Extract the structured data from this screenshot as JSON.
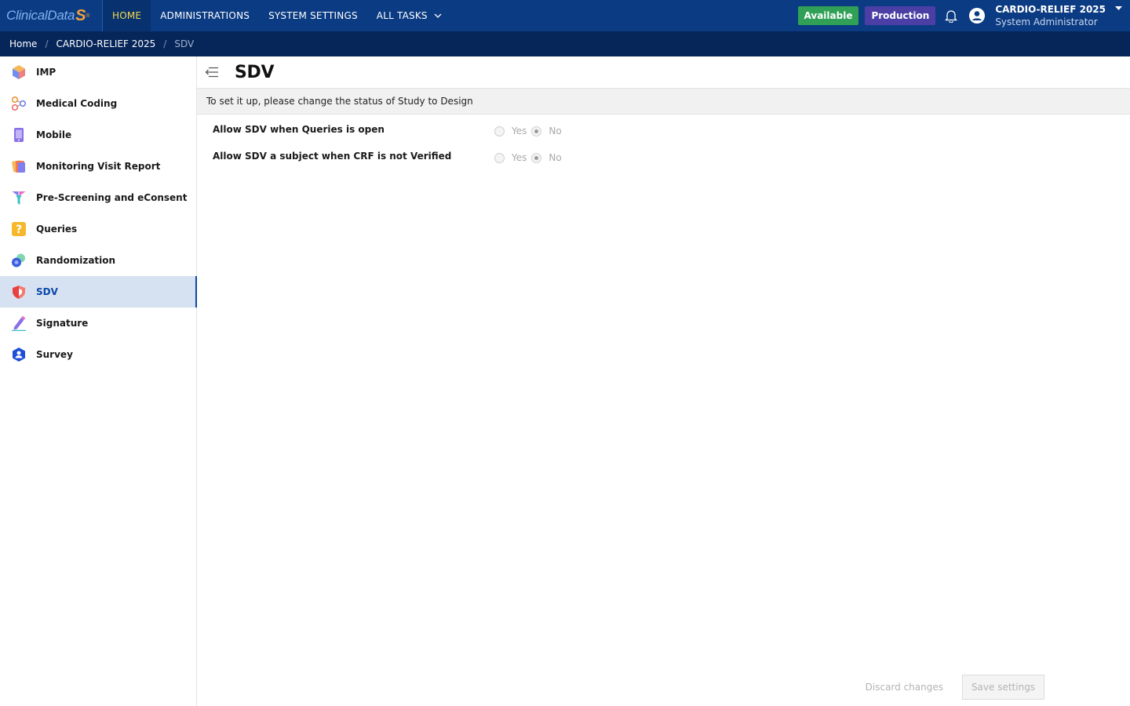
{
  "topbar": {
    "logo_text": "ClinicalData",
    "logo_mark": "S",
    "logo_reg": "®",
    "nav": [
      {
        "label": "HOME",
        "active": true
      },
      {
        "label": "ADMINISTRATIONS",
        "active": false
      },
      {
        "label": "SYSTEM SETTINGS",
        "active": false
      },
      {
        "label": "ALL TASKS",
        "active": false
      }
    ],
    "status_badge": "Available",
    "env_badge": "Production",
    "user_study": "CARDIO-RELIEF 2025",
    "user_role": "System Administrator"
  },
  "breadcrumb": [
    "Home",
    "CARDIO-RELIEF 2025",
    "SDV"
  ],
  "breadcrumb_sep": "/",
  "sidebar": {
    "items": [
      {
        "label": "IMP",
        "icon": "cube-icon"
      },
      {
        "label": "Medical Coding",
        "icon": "molecule-icon"
      },
      {
        "label": "Mobile",
        "icon": "phone-icon"
      },
      {
        "label": "Monitoring Visit Report",
        "icon": "report-icon"
      },
      {
        "label": "Pre-Screening and eConsent",
        "icon": "funnel-icon"
      },
      {
        "label": "Queries",
        "icon": "question-icon"
      },
      {
        "label": "Randomization",
        "icon": "circles-icon"
      },
      {
        "label": "SDV",
        "icon": "shield-icon",
        "active": true
      },
      {
        "label": "Signature",
        "icon": "pen-icon"
      },
      {
        "label": "Survey",
        "icon": "person-hex-icon"
      }
    ]
  },
  "main": {
    "title": "SDV",
    "notice": "To set it up, please change the status of Study to Design",
    "settings": [
      {
        "label": "Allow SDV when Queries is open",
        "yes": "Yes",
        "no": "No",
        "value": "No"
      },
      {
        "label": "Allow SDV a subject when CRF is not Verified",
        "yes": "Yes",
        "no": "No",
        "value": "No"
      }
    ],
    "discard_label": "Discard changes",
    "save_label": "Save settings"
  },
  "colors": {
    "topbar": "#0b3b82",
    "breadcrumb_bar": "#06265a",
    "active_nav_text": "#f5d84a",
    "available": "#2fa055",
    "production": "#4b3fa6",
    "sidebar_active_bg": "#d6e2f1",
    "sidebar_active_text": "#0b47a8"
  }
}
